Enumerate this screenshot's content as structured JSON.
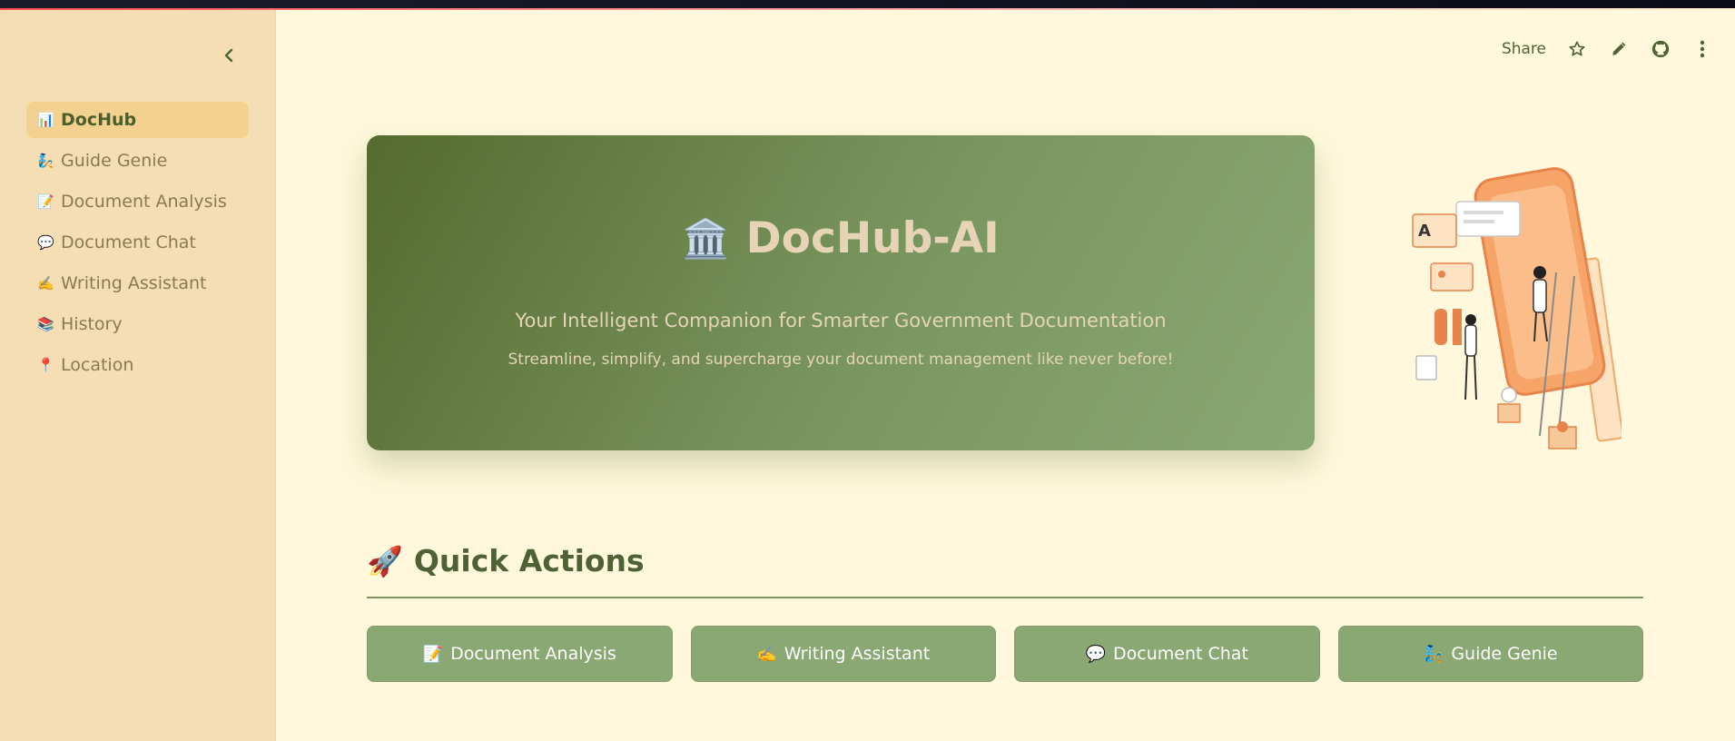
{
  "sidebar": {
    "items": [
      {
        "icon": "📊",
        "label": "DocHub",
        "active": true
      },
      {
        "icon": "🧞",
        "label": "Guide Genie"
      },
      {
        "icon": "📝",
        "label": "Document Analysis"
      },
      {
        "icon": "💬",
        "label": "Document Chat"
      },
      {
        "icon": "✍️",
        "label": "Writing Assistant"
      },
      {
        "icon": "📚",
        "label": "History"
      },
      {
        "icon": "📍",
        "label": "Location"
      }
    ]
  },
  "header": {
    "share_label": "Share",
    "icons": [
      "star-icon",
      "edit-icon",
      "github-icon",
      "more-menu-icon"
    ]
  },
  "hero": {
    "icon": "🏛️",
    "title": "DocHub-AI",
    "subtitle": "Your Intelligent Companion for Smarter Government Documentation",
    "tagline": "Streamline, simplify, and supercharge your document management like never before!"
  },
  "quick_actions": {
    "icon": "🚀",
    "heading": "Quick Actions",
    "buttons": [
      {
        "icon": "📝",
        "label": "Document Analysis"
      },
      {
        "icon": "✍️",
        "label": "Writing Assistant"
      },
      {
        "icon": "💬",
        "label": "Document Chat"
      },
      {
        "icon": "🧞",
        "label": "Guide Genie"
      }
    ]
  },
  "colors": {
    "background": "#fff8dc",
    "sidebar": "#f5deb3",
    "accent": "#556b2f",
    "button": "#8aa874"
  }
}
